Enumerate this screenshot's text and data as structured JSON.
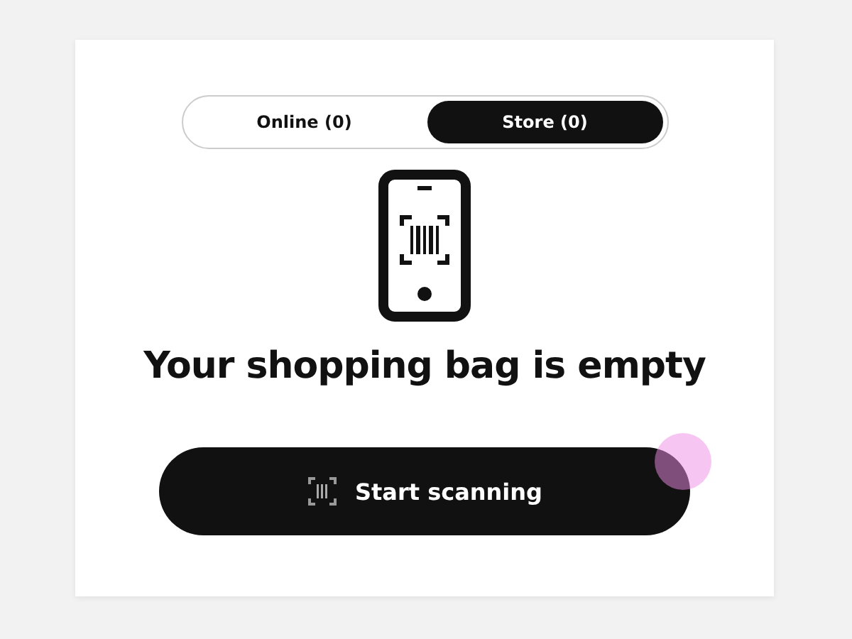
{
  "tabs": [
    {
      "label": "Online (0)",
      "selected": false
    },
    {
      "label": "Store (0)",
      "selected": true
    }
  ],
  "empty_state": {
    "title": "Your shopping bag is empty"
  },
  "button": {
    "label": "Start scanning"
  }
}
